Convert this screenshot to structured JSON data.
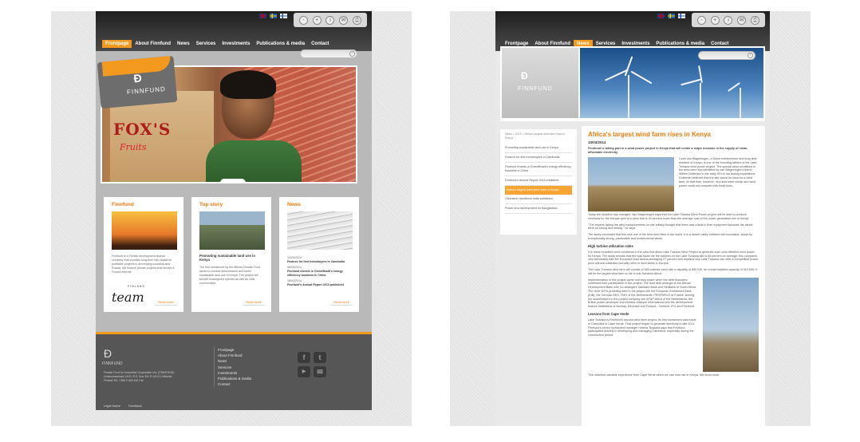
{
  "left": {
    "flags": [
      "en-flag-icon",
      "sv-flag-icon",
      "fi-flag-icon"
    ],
    "tools": [
      "-",
      "+",
      "i",
      "✉",
      "⎙"
    ],
    "nav": [
      {
        "label": "Frontpage",
        "active": true
      },
      {
        "label": "About Finnfund",
        "active": false
      },
      {
        "label": "News",
        "active": false
      },
      {
        "label": "Services",
        "active": false
      },
      {
        "label": "Investments",
        "active": false
      },
      {
        "label": "Publications & media",
        "active": false
      },
      {
        "label": "Contact",
        "active": false
      }
    ],
    "hero": {
      "box_text": "FOX'S",
      "box_sub": "Fruits",
      "logo_word": "FINNFUND"
    },
    "cards": [
      {
        "title": "Finnfund",
        "text": "Finnfund is a Finnish development finance company that provides long-term risk capital for profitable projects in developing countries and Russia. We finance private projects that involve a Finnish interest.",
        "logo_sub": "FINLAND",
        "logo": "team",
        "more": "Read more"
      },
      {
        "title": "Top story",
        "headline": "Promoting sustainable land use in Kenya",
        "text": "The first investment by the Affinita Climate Fund seeks to combat deforestation and foster sustainable land use in Kenya. The project will benefit endangered species as well as local communities.",
        "more": "Read more"
      },
      {
        "title": "News",
        "items": [
          {
            "date": "10/05/2014",
            "title": "Finance for first homebuyers in Cambodia"
          },
          {
            "date": "06/05/2014",
            "title": "Finnfund invests in GreenBrazil's energy efficiency business in China"
          },
          {
            "date": "18/04/2014",
            "title": "Finnfund's Annual Report 2013 published"
          }
        ],
        "more": "Read more"
      }
    ],
    "footer": {
      "logo_word": "FINNFUND",
      "address": "Finnish Fund for Industrial Cooperation Ltd. (FINNFUND) Uudenmaankatu 16 B | P.O. Box 391 FI-00121 Helsinki, Finland Tel. +358 9 348 434 Fax",
      "links": [
        "Frontpage",
        "About Finnfund",
        "News",
        "Services",
        "Investments",
        "Publications & media",
        "Contact"
      ],
      "bottom": [
        "Legal Notice",
        "Feedback"
      ]
    }
  },
  "right": {
    "nav": [
      {
        "label": "Frontpage",
        "active": false
      },
      {
        "label": "About Finnfund",
        "active": false
      },
      {
        "label": "News",
        "active": true
      },
      {
        "label": "Services",
        "active": false
      },
      {
        "label": "Investments",
        "active": false
      },
      {
        "label": "Publications & media",
        "active": false
      },
      {
        "label": "Contact",
        "active": false
      }
    ],
    "logo_word": "FINNFUND",
    "sidebar": {
      "breadcrumb": "News > 2014 > Africa's largest wind farm rises in Kenya",
      "items": [
        {
          "label": "Promoting sustainable land use in Kenya",
          "active": false
        },
        {
          "label": "Finance for first homebuyers in Cambodia",
          "active": false
        },
        {
          "label": "Finnfund invests in GreenBrazil's energy efficiency business in China",
          "active": false
        },
        {
          "label": "Finnfund's Annual Report 2013 published",
          "active": false
        },
        {
          "label": "Africa's largest wind farm rises in Kenya",
          "active": true
        },
        {
          "label": "Cleantech handbook India published",
          "active": false
        },
        {
          "label": "Power and development for Bangladesh",
          "active": false
        }
      ]
    },
    "article": {
      "title": "Africa's largest wind farm rises in Kenya",
      "date": "10/03/2014",
      "lead": "Finnfund is taking part in a wind power project in Kenya that will create a major increase in the supply of clean, affordable electricity.",
      "p1": "Carlo van Wageningen, a Dutch entrepreneur and long-time resident of Kenya, is one of the founding fathers of the Lake Turkana wind power project. The special wind conditions in the area were first identified by van Wageningen's friend Willem Dolleman in the early 90's in his fishing expeditions. Dolleman believed that the site would be ideal for a wind farm. At that time, however, oil prices were cheap and wind power could not compete with fossil fuels.",
      "p2": "Today the situation has changed. Van Wageningen says that the Lake Turkana Wind Power project will be able to produce electricity for the Kenyan grid at a price that is 40 percent lower than the average cost of the power generation mix in Kenya.",
      "p3": "\"The experts taking the wind measurements on site initially thought that there was a fault in their equipment because the winds were so strong and steady,\" he says.",
      "p4": "The study concluded that this was one of the best wind sites in the world. It is a desert valley between tall mountains, swept by exceptionally strong, predictable and unidirectional winds.",
      "h1": "High turbine utilisation rates",
      "p5": "It is these excellent wind conditions in the area that allow Lake Turkana Wind Project to generate such cost-effective wind power for Kenya. The study reveals that the load factor for the turbines on the Lake Turkana site is 55 percent on average; this compares very favourably with the European load factors averaging 27 percent and explains why Lake Turkana can offer a competitive power price without subsidies normally seen in wind farms in Europe.",
      "p6": "The Lake Turkana wind farm will consist of 365 turbines each with a capacity of 850 KW, for a total installed capacity of 310 MW. It will be the largest wind farm so far in sub-Saharan Africa.",
      "p7": "Implementation of the project came one step closer when the debt financiers confirmed their participation in the project. The lead debt arranger is the African Development Bank with Co-arrangers Standard Bank and Nedbank of South Africa. The other DFI's providing debt to the project are the European Investment Bank (EIB), the German DEG, FMO of the Netherlands, PROPARCO of France. Among the shareholders in the project company are KP&P Africa of the Netherlands, the British power developer and investor Aldwych International and the development finance institutions of Norway, Denmark and Finland – Norfund, IFU and Finnfund.",
      "h2": "Lessons from Cape Verde",
      "p8": "Lake Turkana is Finnfund's second wind farm project. Its first investment was made in Cabeólica in Cape Verde. That project began to generate electricity in late 2011. Finnfund's senior investment manager Helena Teppana says that Finnfund participated actively in developing and managing Cabeólica, especially during the construction period.",
      "p9": "\"We obtained valuable experience from Cape Verde which we can now use in Kenya. We know most"
    }
  }
}
